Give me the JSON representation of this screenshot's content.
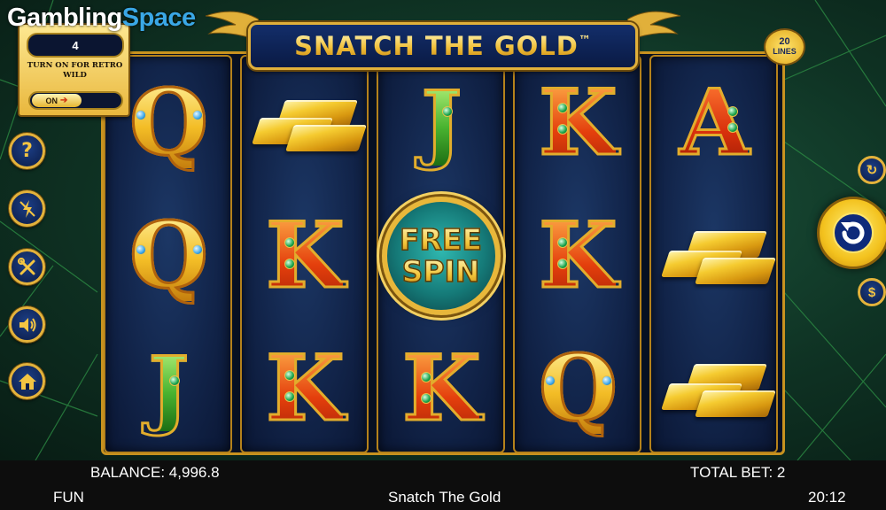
{
  "brand": {
    "word1": "Gambling",
    "word2": "Space"
  },
  "title": "SNATCH THE GOLD",
  "title_mark": "™",
  "lines_badge": {
    "number": "20",
    "label": "LINES"
  },
  "retro_panel": {
    "count": "4",
    "text": "TURN ON FOR RETRO WILD",
    "toggle_label": "ON"
  },
  "side_buttons": [
    {
      "name": "help-button",
      "icon": "question-icon"
    },
    {
      "name": "turbo-button",
      "icon": "lightning-icon"
    },
    {
      "name": "settings-button",
      "icon": "tools-icon"
    },
    {
      "name": "sound-button",
      "icon": "speaker-icon"
    },
    {
      "name": "home-button",
      "icon": "home-icon"
    }
  ],
  "reels": [
    [
      "Q",
      "Q",
      "J"
    ],
    [
      "GOLD",
      "K",
      "K"
    ],
    [
      "J",
      "FREE SPIN",
      "K"
    ],
    [
      "K",
      "K",
      "Q"
    ],
    [
      "A",
      "GOLD",
      "GOLD"
    ]
  ],
  "free_spin": {
    "line1": "FREE",
    "line2": "SPIN"
  },
  "info_bar": {
    "balance": "BALANCE: 4,996.8",
    "total_bet": "TOTAL BET: 2"
  },
  "status_bar": {
    "mode": "FUN",
    "game_name": "Snatch The Gold",
    "time": "20:12"
  },
  "colors": {
    "accent_gold": "#e1b03a",
    "panel_navy": "#112348",
    "felt_green": "#0f3324"
  }
}
